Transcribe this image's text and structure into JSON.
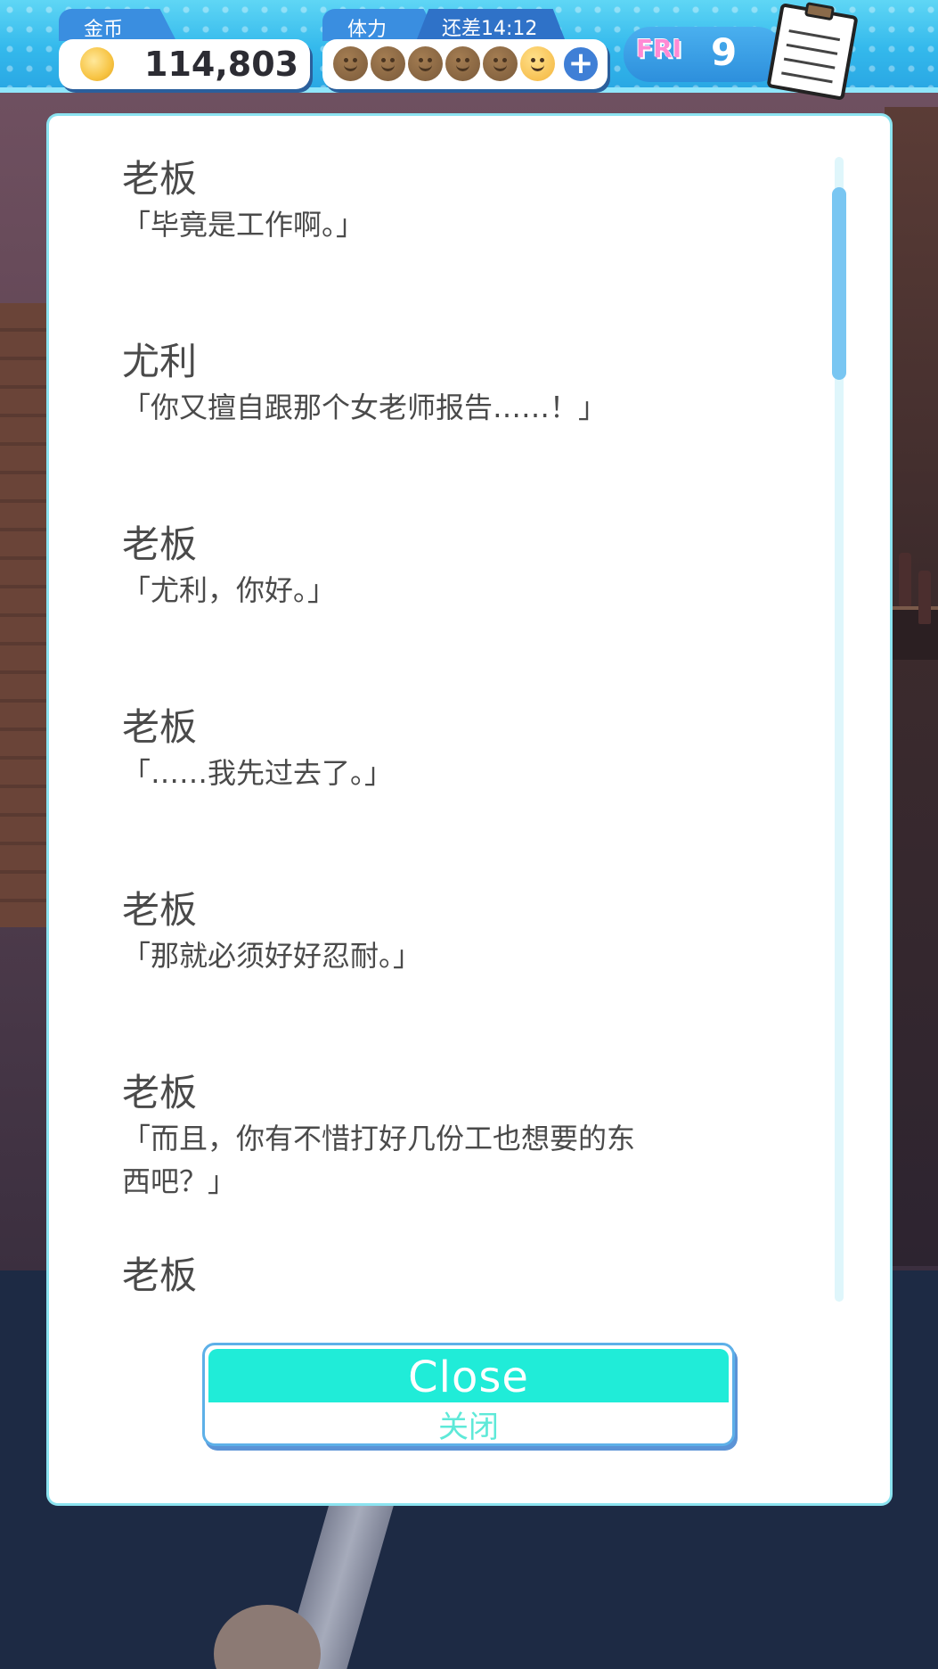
{
  "hud": {
    "coins": {
      "label": "金币",
      "value": "114,803"
    },
    "stamina": {
      "label": "体力",
      "timer": "还差14:12",
      "max": 6,
      "current": 1,
      "plus_glyph": "+"
    },
    "day": {
      "name": "FRI",
      "number": "9"
    },
    "icons": [
      "coin-icon",
      "stamina-face-icon",
      "plus-icon",
      "notepad-icon"
    ]
  },
  "log": {
    "entries": [
      {
        "speaker": "老板",
        "line": "「毕竟是工作啊。」"
      },
      {
        "speaker": "尤利",
        "line": "「你又擅自跟那个女老师报告……！」"
      },
      {
        "speaker": "老板",
        "line": "「尤利，你好。」"
      },
      {
        "speaker": "老板",
        "line": "「……我先过去了。」"
      },
      {
        "speaker": "老板",
        "line": "「那就必须好好忍耐。」"
      },
      {
        "speaker": "老板",
        "line": "「而且，你有不惜打好几份工也想要的东",
        "line2": "西吧？」"
      },
      {
        "speaker": "老板",
        "line": ""
      }
    ]
  },
  "close_button": {
    "label_en": "Close",
    "label_zh": "关闭"
  },
  "colors": {
    "hud_blue": "#34b9ec",
    "close_teal": "#20ecd8",
    "text_gray": "#4a4a4a",
    "day_pink": "#ff8ad4"
  }
}
